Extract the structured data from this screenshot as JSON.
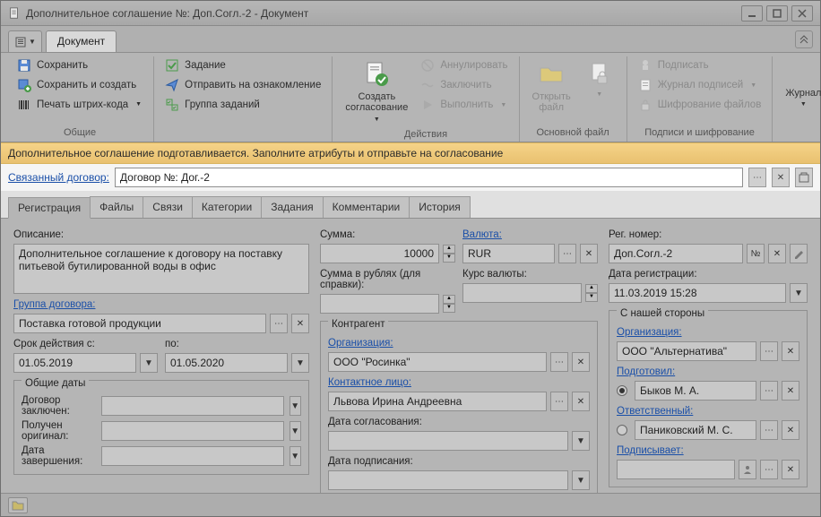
{
  "window": {
    "title": "Дополнительное соглашение №: Доп.Согл.-2 - Документ"
  },
  "menu": {
    "doc_tab": "Документ"
  },
  "ribbon": {
    "general": {
      "label": "Общие",
      "save": "Сохранить",
      "save_create": "Сохранить и создать",
      "barcode": "Печать штрих-кода"
    },
    "tasks": {
      "task": "Задание",
      "send_review": "Отправить на ознакомление",
      "task_group": "Группа заданий"
    },
    "actions": {
      "label": "Действия",
      "create_approval": "Создать\nсогласование",
      "annul": "Аннулировать",
      "conclude": "Заключить",
      "execute": "Выполнить"
    },
    "main_file": {
      "label": "Основной файл",
      "open_file": "Открыть\nфайл"
    },
    "sign_enc": {
      "label": "Подписи и шифрование",
      "sign": "Подписать",
      "sign_log": "Журнал подписей",
      "encrypt": "Шифрование файлов"
    },
    "journal": "Журнал"
  },
  "infobar": "Дополнительное соглашение подготавливается. Заполните атрибуты и отправьте на согласование",
  "linked": {
    "label": "Связанный договор:",
    "value": "Договор №: Дог.-2"
  },
  "tabs": [
    "Регистрация",
    "Файлы",
    "Связи",
    "Категории",
    "Задания",
    "Комментарии",
    "История"
  ],
  "form": {
    "description_label": "Описание:",
    "description": "Дополнительное соглашение к договору на поставку питьевой бутилированной воды в офис",
    "contract_group_label": "Группа договора:",
    "contract_group": "Поставка готовой продукции",
    "valid_from_label": "Срок действия с:",
    "valid_from": "01.05.2019",
    "valid_to_label": "по:",
    "valid_to": "01.05.2020",
    "common_dates_label": "Общие даты",
    "concluded_label": "Договор заключен:",
    "original_received_label": "Получен оригинал:",
    "completion_date_label": "Дата завершения:",
    "sum_label": "Сумма:",
    "sum": "10000",
    "currency_label": "Валюта:",
    "currency": "RUR",
    "sum_rub_label": "Сумма в рублях (для справки):",
    "rate_label": "Курс валюты:",
    "counterparty_label": "Контрагент",
    "organization_label": "Организация:",
    "organization": "ООО \"Росинка\"",
    "contact_label": "Контактное лицо:",
    "contact": "Львова Ирина Андреевна",
    "approval_date_label": "Дата согласования:",
    "sign_date_label": "Дата подписания:",
    "reg_no_label": "Рег. номер:",
    "reg_no": "Доп.Согл.-2",
    "reg_date_label": "Дата регистрации:",
    "reg_date": "11.03.2019 15:28",
    "our_side_label": "С нашей стороны",
    "our_org_label": "Организация:",
    "our_org": "ООО \"Альтернатива\"",
    "prepared_label": "Подготовил:",
    "prepared": "Быков М. А.",
    "responsible_label": "Ответственный:",
    "responsible": "Паниковский М. С.",
    "signer_label": "Подписывает:"
  }
}
